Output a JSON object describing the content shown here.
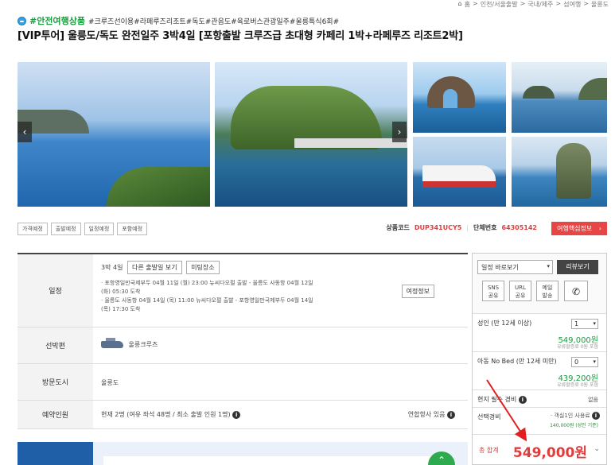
{
  "breadcrumb": {
    "items": [
      "홈",
      ">",
      "인천/서울출발",
      ">",
      "국내/제주",
      ">",
      "섬여행",
      ">",
      "울릉도"
    ]
  },
  "header": {
    "badge": "#안전여행상품",
    "tags": "#크루즈선이용#라페루즈리조트#독도#관음도#육로버스관광일주#울릉특식6회#",
    "title": "[VIP투어] 울릉도/독도 완전일주 3박4일 [포항출발 크루즈급 초대형 카페리 1박+라페루즈 리조트2박]"
  },
  "gallery": {
    "prev": "‹",
    "next": "›"
  },
  "tabs": [
    "가격예정",
    "출발예정",
    "일정예정",
    "포함예정"
  ],
  "codes": {
    "product_label": "상품코드",
    "product_value": "DUP341UCY5",
    "group_label": "단체번호",
    "group_value": "64305142",
    "keyinfo_label": "여행핵심정보",
    "keyinfo_arrow": "›"
  },
  "table": {
    "schedule_label": "일정",
    "duration": "3박 4일",
    "other_dates_btn": "다른 출발일 보기",
    "meeting_btn": "미팅장소",
    "sched_lines": [
      "· 포항영일만국제부두 04월 11일 (월) 23:00 뉴씨다오펄 출발 - 울릉도 사동항 04월 12일",
      "  (화) 05:30 도착",
      "· 울릉도 사동항 04월 14일 (목) 11:00 뉴씨다오펄 출발 - 포항영일만국제부두 04월 14일",
      "  (목) 17:30 도착"
    ],
    "tour_info_btn": "여정정보",
    "ship_label": "선박편",
    "ship_value": "울릉크루즈",
    "city_label": "방문도시",
    "city_value": "울릉도",
    "reserve_label": "예약인원",
    "reserve_value": "현재 2명 (여유 좌석 48명 / 최소 출발 인원 1명)",
    "partner": "연합항사 있음"
  },
  "sidebar": {
    "select": "일정 바로보기",
    "review_btn": "리뷰보기",
    "sns": [
      "SNS",
      "공유"
    ],
    "url": [
      "URL",
      "공유"
    ],
    "mail": [
      "메일",
      "발송"
    ],
    "adult_label": "성인 (만 12세 이상)",
    "adult_qty": "1",
    "adult_price": "549,000원",
    "adult_note": "유류할증료 0원 포함",
    "child_label": "아동 No Bed (만 12세 미만)",
    "child_qty": "0",
    "child_price": "439,200원",
    "child_note": "유류할증료 0원 포함",
    "local_label": "현지 필수 경비",
    "local_value": "없음",
    "option_label": "선택경비",
    "option_value": "· 객실1인 사용료",
    "option_sub": "140,000원 (성인 기준)",
    "total_label": "총 합계",
    "total_value": "549,000원"
  },
  "colors": {
    "accent_red": "#e03e3e",
    "green": "#1a9b3f",
    "banner_blue": "#1e5fa8"
  }
}
